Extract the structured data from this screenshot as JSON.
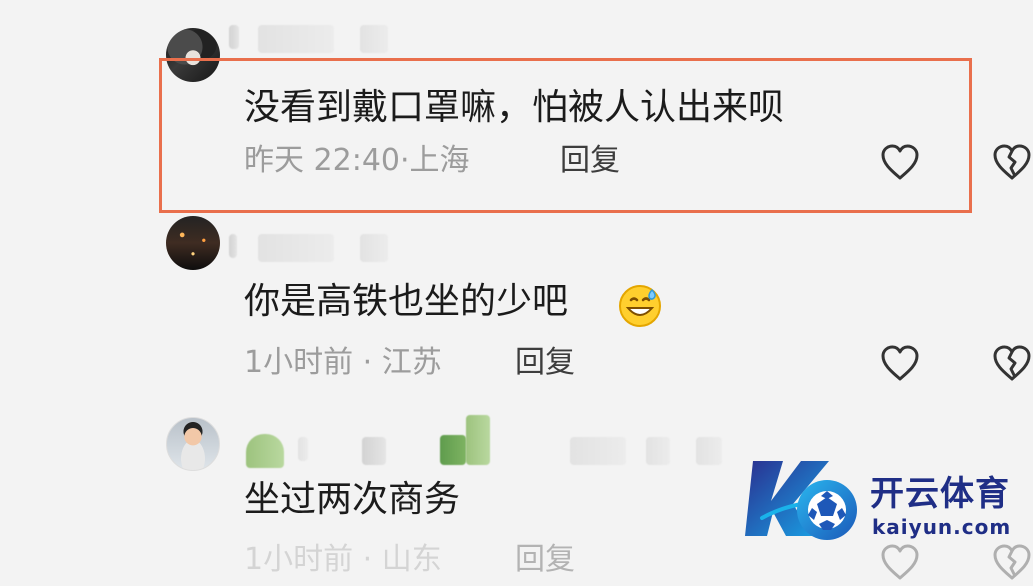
{
  "comments": [
    {
      "text": "没看到戴口罩嘛，怕被人认出来呗",
      "time": "昨天 22:40",
      "location": "上海",
      "reply_label": "回复"
    },
    {
      "text": "你是高铁也坐的少吧",
      "time": "1小时前",
      "location": "江苏",
      "reply_label": "回复"
    },
    {
      "text": "坐过两次商务",
      "time": "1小时前",
      "location": "山东",
      "reply_label": "回复"
    }
  ],
  "icons": {
    "like": "heart-outline-icon",
    "dislike": "broken-heart-icon",
    "emoji": "grinning-sweat-emoji-icon",
    "watermark_logo": "kaiyun-logo-icon"
  },
  "colors": {
    "highlight": "#e96f4c",
    "meta_text": "#9c9c9c",
    "brand_blue": "#1f2e86",
    "brand_cyan": "#20b7ea"
  },
  "watermark": {
    "brand_name": "开云体育",
    "domain": "kaiyun.com"
  }
}
